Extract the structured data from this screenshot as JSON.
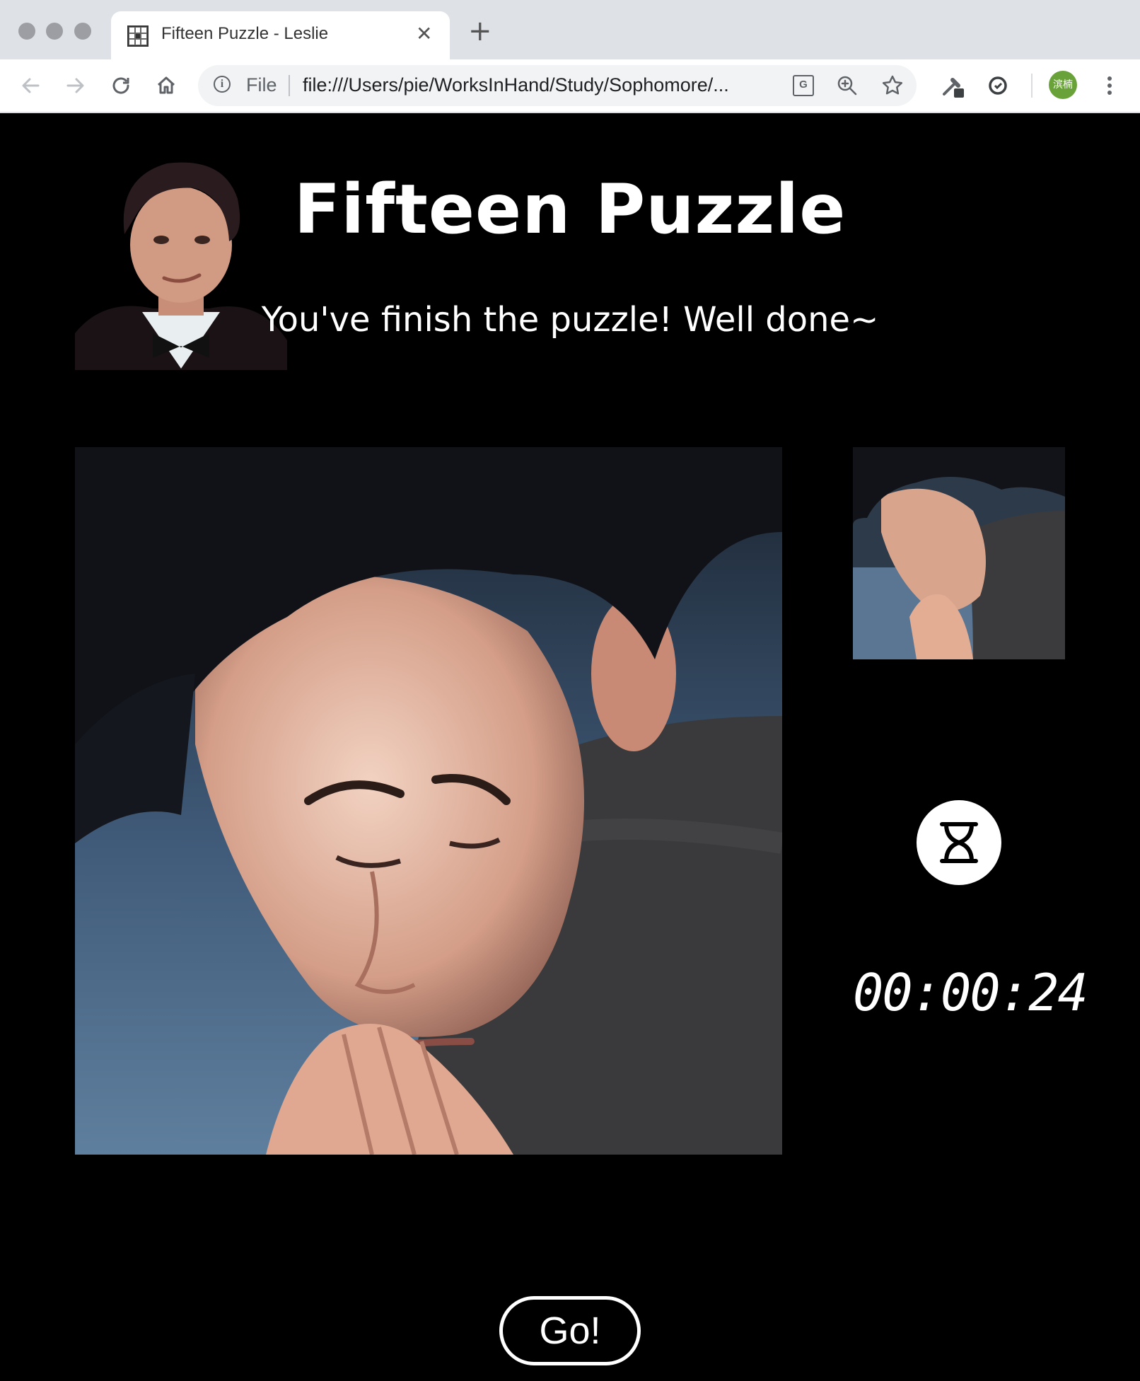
{
  "browser": {
    "tab": {
      "title": "Fifteen Puzzle - Leslie",
      "favicon": "grid-puzzle-icon",
      "close_icon": "close-icon"
    },
    "new_tab_icon": "plus-icon",
    "nav": {
      "back_icon": "back-arrow-icon",
      "forward_icon": "forward-arrow-icon",
      "reload_icon": "reload-icon",
      "home_icon": "home-icon"
    },
    "address_bar": {
      "scheme_label": "File",
      "url": "file:///Users/pie/WorksInHand/Study/Sophomore/..."
    },
    "profile_label": "滨楠"
  },
  "page": {
    "title": "Fifteen Puzzle",
    "message": "You've finish the puzzle! Well done~",
    "timer": "00:00:24",
    "go_button": "Go!",
    "timer_icon": "hourglass-icon"
  },
  "colors": {
    "background": "#000000",
    "text": "#ffffff",
    "chrome_tabbar": "#dee1e6",
    "omnibox": "#f1f3f4",
    "profile_avatar": "#6aa23a"
  }
}
